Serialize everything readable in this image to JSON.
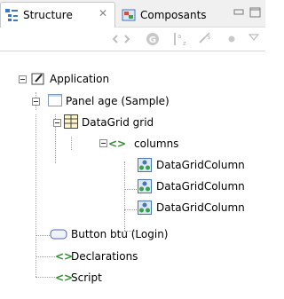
{
  "tabs": [
    {
      "label": "Structure",
      "active": true,
      "icon": "structure-icon",
      "close": "✕"
    },
    {
      "label": "Composants",
      "active": false,
      "icon": "components-icon"
    }
  ],
  "toolbar": {
    "items": [
      "back-forward-icon",
      "refresh-icon",
      "sort-az-icon",
      "filter-icon",
      "dot-icon",
      "view-menu-icon"
    ]
  },
  "tree": {
    "application": "Application",
    "panel": "Panel age (Sample)",
    "datagrid": "DataGrid grid",
    "columns": "columns",
    "column1": "DataGridColumn",
    "column2": "DataGridColumn",
    "column3": "DataGridColumn",
    "button": "Button btu (Login)",
    "declarations": "Declarations",
    "script": "Script"
  },
  "colors": {
    "accent": "#2e8b2e",
    "tab_border": "#c8c8c8"
  }
}
